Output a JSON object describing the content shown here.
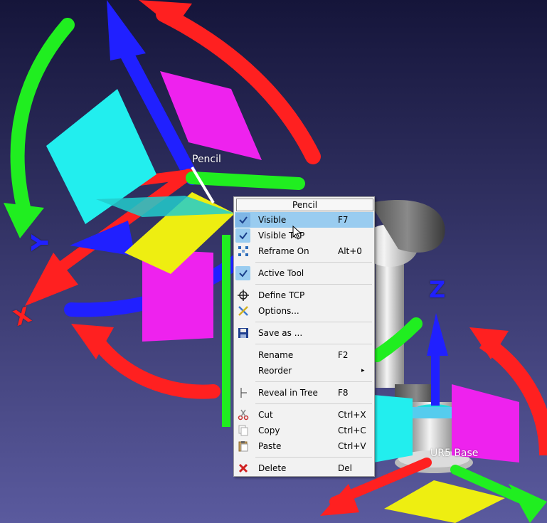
{
  "viewport": {
    "tool_label": "Pencil",
    "base_label": "UR5 Base",
    "axis_x": "X",
    "axis_y": "Y",
    "axis_z": "Z",
    "colors": {
      "background_top": "#15153a",
      "background_bottom": "#5a5a9e",
      "x_axis": "#ff2020",
      "y_axis": "#20ee20",
      "z_axis": "#2020ff",
      "plane_cyan": "#22eeee",
      "plane_magenta": "#ee22ee",
      "plane_yellow": "#eeee11"
    }
  },
  "context_menu": {
    "title": "Pencil",
    "items": [
      {
        "label": "Visible",
        "shortcut": "F7",
        "icon": "check-icon",
        "checked": true,
        "highlighted": true
      },
      {
        "label": "Visible TCP",
        "shortcut": "",
        "icon": "check-icon",
        "checked": true
      },
      {
        "label": "Reframe On",
        "shortcut": "Alt+0",
        "icon": "reframe-icon"
      },
      {
        "label": "Active Tool",
        "shortcut": "",
        "icon": "check-icon",
        "checked": true
      },
      {
        "label": "Define TCP",
        "shortcut": "",
        "icon": "crosshair-icon"
      },
      {
        "label": "Options...",
        "shortcut": "",
        "icon": "options-icon"
      },
      {
        "label": "Save as ...",
        "shortcut": "",
        "icon": "save-icon"
      },
      {
        "label": "Rename",
        "shortcut": "F2",
        "icon": ""
      },
      {
        "label": "Reorder",
        "shortcut": "",
        "icon": "",
        "submenu": true
      },
      {
        "label": "Reveal in Tree",
        "shortcut": "F8",
        "icon": "tree-icon"
      },
      {
        "label": "Cut",
        "shortcut": "Ctrl+X",
        "icon": "scissors-icon"
      },
      {
        "label": "Copy",
        "shortcut": "Ctrl+C",
        "icon": "copy-icon"
      },
      {
        "label": "Paste",
        "shortcut": "Ctrl+V",
        "icon": "paste-icon"
      },
      {
        "label": "Delete",
        "shortcut": "Del",
        "icon": "delete-icon"
      }
    ],
    "submenu_arrow": "▸"
  }
}
